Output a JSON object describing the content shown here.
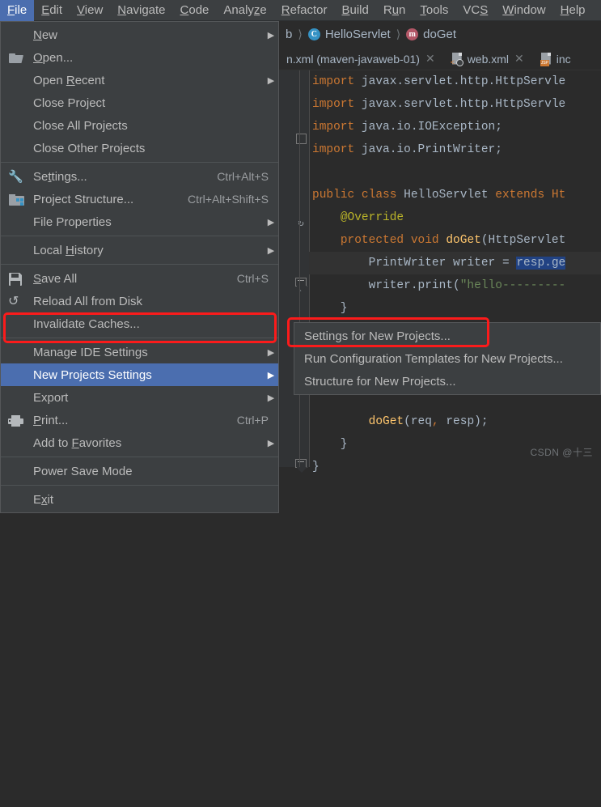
{
  "app": {
    "title": "IntelliJ IDEA",
    "watermark": "CSDN @十三",
    "accent_blue": "#4b6eaf",
    "annotation_red": "#fb1b1b",
    "menu_bg": "#3c3f41",
    "editor_bg": "#2b2b2b"
  },
  "menubar": {
    "items": [
      {
        "label": "File",
        "mnemonic": "F",
        "active": true
      },
      {
        "label": "Edit",
        "mnemonic": "E",
        "active": false
      },
      {
        "label": "View",
        "mnemonic": "V",
        "active": false
      },
      {
        "label": "Navigate",
        "mnemonic": "N",
        "active": false
      },
      {
        "label": "Code",
        "mnemonic": "C",
        "active": false
      },
      {
        "label": "Analyze",
        "mnemonic": "z",
        "active": false
      },
      {
        "label": "Refactor",
        "mnemonic": "R",
        "active": false
      },
      {
        "label": "Build",
        "mnemonic": "B",
        "active": false
      },
      {
        "label": "Run",
        "mnemonic": "u",
        "active": false
      },
      {
        "label": "Tools",
        "mnemonic": "T",
        "active": false
      },
      {
        "label": "VCS",
        "mnemonic": "S",
        "active": false
      },
      {
        "label": "Window",
        "mnemonic": "W",
        "active": false
      },
      {
        "label": "Help",
        "mnemonic": "H",
        "active": false
      }
    ]
  },
  "file_menu": {
    "items": [
      {
        "label": "New",
        "accel": "",
        "arrow": true,
        "icon": "none",
        "selected": false
      },
      {
        "label": "Open...",
        "accel": "",
        "arrow": false,
        "icon": "folder-open-icon",
        "selected": false
      },
      {
        "label": "Open Recent",
        "accel": "",
        "arrow": true,
        "icon": "none",
        "selected": false
      },
      {
        "label": "Close Project",
        "accel": "",
        "arrow": false,
        "icon": "none",
        "selected": false
      },
      {
        "label": "Close All Projects",
        "accel": "",
        "arrow": false,
        "icon": "none",
        "selected": false
      },
      {
        "label": "Close Other Projects",
        "accel": "",
        "arrow": false,
        "icon": "none",
        "selected": false
      },
      {
        "separator": true
      },
      {
        "label": "Settings...",
        "accel": "Ctrl+Alt+S",
        "arrow": false,
        "icon": "wrench-icon",
        "selected": false
      },
      {
        "label": "Project Structure...",
        "accel": "Ctrl+Alt+Shift+S",
        "arrow": false,
        "icon": "project-structure-icon",
        "selected": false
      },
      {
        "label": "File Properties",
        "accel": "",
        "arrow": true,
        "icon": "none",
        "selected": false
      },
      {
        "separator": true
      },
      {
        "label": "Local History",
        "accel": "",
        "arrow": true,
        "icon": "none",
        "selected": false
      },
      {
        "separator": true
      },
      {
        "label": "Save All",
        "accel": "Ctrl+S",
        "arrow": false,
        "icon": "save-icon",
        "selected": false
      },
      {
        "label": "Reload All from Disk",
        "accel": "",
        "arrow": false,
        "icon": "reload-icon",
        "selected": false
      },
      {
        "label": "Invalidate Caches...",
        "accel": "",
        "arrow": false,
        "icon": "none",
        "selected": false
      },
      {
        "separator": true
      },
      {
        "label": "Manage IDE Settings",
        "accel": "",
        "arrow": true,
        "icon": "none",
        "selected": false
      },
      {
        "label": "New Projects Settings",
        "accel": "",
        "arrow": true,
        "icon": "none",
        "selected": true
      },
      {
        "label": "Export",
        "accel": "",
        "arrow": true,
        "icon": "none",
        "selected": false
      },
      {
        "label": "Print...",
        "accel": "Ctrl+P",
        "arrow": false,
        "icon": "print-icon",
        "selected": false
      },
      {
        "label": "Add to Favorites",
        "accel": "",
        "arrow": true,
        "icon": "none",
        "selected": false
      },
      {
        "separator": true
      },
      {
        "label": "Power Save Mode",
        "accel": "",
        "arrow": false,
        "icon": "none",
        "selected": false
      },
      {
        "separator": true
      },
      {
        "label": "Exit",
        "accel": "",
        "arrow": false,
        "icon": "none",
        "selected": false
      }
    ]
  },
  "submenu": {
    "items": [
      {
        "label": "Settings for New Projects..."
      },
      {
        "label": "Run Configuration Templates for New Projects..."
      },
      {
        "label": "Structure for New Projects..."
      }
    ]
  },
  "editor": {
    "breadcrumb": [
      {
        "text": "b",
        "icon": "none"
      },
      {
        "text": "HelloServlet",
        "icon": "class-icon",
        "icon_letter": "C"
      },
      {
        "text": "doGet",
        "icon": "method-icon",
        "icon_letter": "m"
      }
    ],
    "tabs": [
      {
        "label": "n.xml (maven-javaweb-01)",
        "icon": "none",
        "closable": true
      },
      {
        "label": "web.xml",
        "icon": "xml-file-icon",
        "closable": true
      },
      {
        "label": "inc",
        "icon": "jsp-file-icon",
        "closable": false
      }
    ],
    "code_lines": [
      "import javax.servlet.http.HttpServle",
      "import javax.servlet.http.HttpServle",
      "import java.io.IOException;",
      "import java.io.PrintWriter;",
      "",
      "public class HelloServlet extends Ht",
      "    @Override",
      "    protected void doGet(HttpServlet",
      "        PrintWriter writer = resp.ge",
      "        writer.print(\"hello---------",
      "    }",
      "",
      "",
      "        doGet(req, resp);",
      "    }",
      "}"
    ],
    "selection_text": "resp.ge",
    "selection_color": "#214283"
  }
}
